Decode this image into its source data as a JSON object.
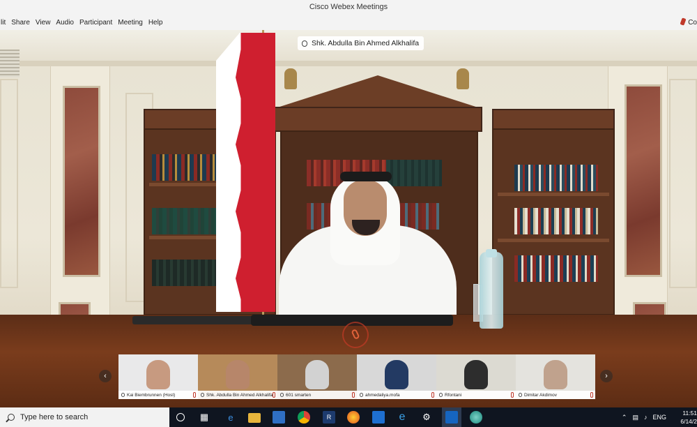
{
  "window": {
    "title": "Cisco Webex Meetings"
  },
  "menu": {
    "items": [
      "lit",
      "Share",
      "View",
      "Audio",
      "Participant",
      "Meeting",
      "Help"
    ],
    "recording_label": "Co"
  },
  "active_speaker": {
    "name": "Shk. Abdulla Bin Ahmed Alkhalifa"
  },
  "thumbnails": [
    {
      "name": "Kai Biembrunnen (Host)",
      "bg": "#e9e9ea",
      "person": "#c79a80"
    },
    {
      "name": "Shk. Abdulla Bin Ahmed Alkhalifa",
      "bg": "#b68a5a",
      "person": "#b7866a"
    },
    {
      "name": "601 smarten",
      "bg": "#8c6b4c",
      "person": "#d2d2d2"
    },
    {
      "name": "ahmedaliya.mofa",
      "bg": "#d8d8d8",
      "person": "#233a63"
    },
    {
      "name": "Rfontani",
      "bg": "#dcdad2",
      "person": "#2d2d2d"
    },
    {
      "name": "Dimitar Akdimov",
      "bg": "#e4e3de",
      "person": "#c0a28d"
    }
  ],
  "taskbar": {
    "search_placeholder": "Type here to search",
    "apps": [
      "task-view",
      "edge",
      "file-explorer",
      "store",
      "chrome",
      "app-red",
      "firefox",
      "mail",
      "ie",
      "settings",
      "outlook",
      "webex"
    ],
    "tray": {
      "language": "ENG",
      "time": "11:51",
      "date": "6/14/2"
    }
  },
  "colors": {
    "flag_red": "#cf1f2f",
    "muted_red": "#e0623a",
    "taskbar": "#0f1520"
  }
}
